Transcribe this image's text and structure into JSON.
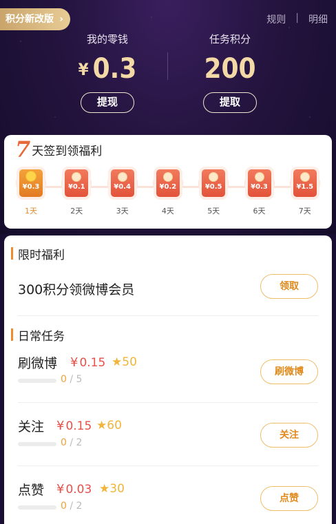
{
  "header": {
    "badge_label": "积分新改版",
    "badge_arrow": "›",
    "rules_label": "规则",
    "separator": "|",
    "details_label": "明细"
  },
  "wallet": {
    "label": "我的零钱",
    "currency": "¥",
    "amount": "0.3",
    "action_label": "提现"
  },
  "points": {
    "label": "任务积分",
    "amount": "200",
    "action_label": "提取"
  },
  "checkin": {
    "title_number": "7",
    "title_text": "天签到领福利",
    "days": [
      {
        "amount": "¥0.3",
        "label": "1天",
        "active": true
      },
      {
        "amount": "¥0.1",
        "label": "2天",
        "active": false
      },
      {
        "amount": "¥0.4",
        "label": "3天",
        "active": false
      },
      {
        "amount": "¥0.2",
        "label": "4天",
        "active": false
      },
      {
        "amount": "¥0.5",
        "label": "5天",
        "active": false
      },
      {
        "amount": "¥0.3",
        "label": "6天",
        "active": false
      },
      {
        "amount": "¥1.5",
        "label": "7天",
        "active": false
      }
    ]
  },
  "limited": {
    "section_title": "限时福利",
    "item_text": "300积分领微博会员",
    "button_label": "领取"
  },
  "daily": {
    "section_title": "日常任务",
    "tasks": [
      {
        "name": "刷微博",
        "money": "0.15",
        "currency": "¥",
        "points": "50",
        "progress_current": "0",
        "progress_total": "/ 5",
        "button_label": "刷微博"
      },
      {
        "name": "关注",
        "money": "0.15",
        "currency": "¥",
        "points": "60",
        "progress_current": "0",
        "progress_total": "/ 2",
        "button_label": "关注"
      },
      {
        "name": "点赞",
        "money": "0.03",
        "currency": "¥",
        "points": "30",
        "progress_current": "0",
        "progress_total": "/ 2",
        "button_label": "点赞"
      }
    ]
  },
  "colors": {
    "accent_gold": "#f3d9a6",
    "accent_orange": "#e08a1c",
    "money_red": "#e8504a",
    "star_yellow": "#f2b43a"
  },
  "icons": {
    "star": "star-icon",
    "red_packet": "red-packet-icon"
  }
}
